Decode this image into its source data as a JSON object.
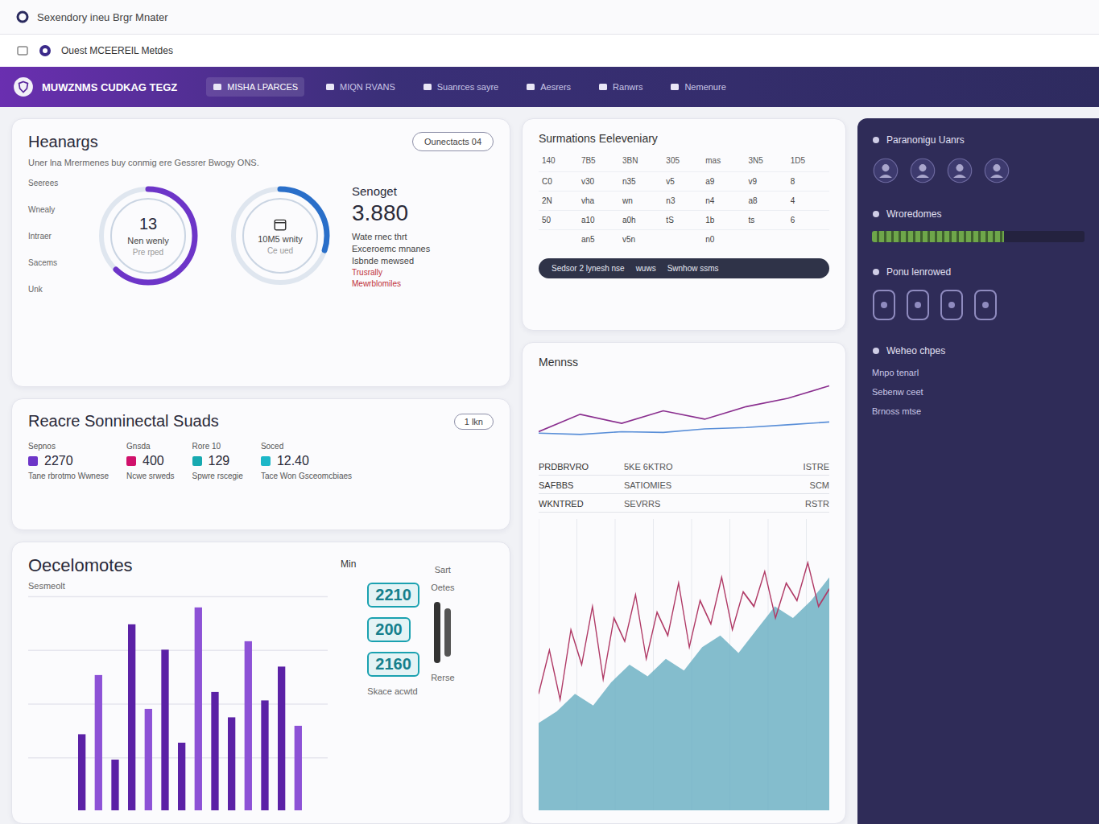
{
  "window": {
    "title": "Sexendory ineu Brgr Mnater",
    "subtitle": "Ouest MCEEREIL Metdes"
  },
  "nav": {
    "brand": "MUWZNMS CUDKAG TEGZ",
    "items": [
      {
        "label": "MISHA LPARCES",
        "selected": true
      },
      {
        "label": "MIQN RVANS",
        "selected": false
      },
      {
        "label": "Suanrces sayre",
        "selected": false
      },
      {
        "label": "Aesrers",
        "selected": false
      },
      {
        "label": "Ranwrs",
        "selected": false
      },
      {
        "label": "Nemenure",
        "selected": false
      }
    ]
  },
  "overview": {
    "title": "Heanargs",
    "subtitle": "Uner lna Mrermenes buy conmig ere Gessrer Bwogy ONS.",
    "button": "Ounectacts  04",
    "rows": [
      "Seerees",
      "Wnealy",
      "Intraer",
      "Sacems",
      "Unk"
    ],
    "rings": [
      {
        "value": "13",
        "label": "Nen wenly",
        "sub": "Pre rped",
        "level": 0.62
      },
      {
        "value": "",
        "label": "10M5 wnity",
        "sub": "Ce ued",
        "level": 0.3
      }
    ],
    "stat": {
      "title": "Senoget",
      "value": "3.880",
      "lines": [
        "Wate rnec thrt",
        "Exceroemc mnanes",
        "Isbnde mewsed"
      ],
      "alerts": [
        "Trusrally",
        "Mewrblomiles"
      ]
    }
  },
  "legend": {
    "title": "Reacre Sonninectal Suads",
    "button": "1 lkn",
    "items": [
      {
        "label": "Sepnos",
        "value": "2270",
        "note": "Tane rbrotmo Wwnese",
        "color": "#6d35c8"
      },
      {
        "label": "Gnsda",
        "value": "400",
        "note": "Ncwe srweds",
        "color": "#d0116b"
      },
      {
        "label": "Rore 10",
        "value": "129",
        "note": "Spwre rscegie",
        "color": "#17a9b0"
      },
      {
        "label": "Soced",
        "value": "12.40",
        "note": "Tace Won Gsceomcbiaes",
        "color": "#1cb7c8"
      }
    ]
  },
  "bars": {
    "title": "Oecelomotes",
    "axis": "Sesmeolt",
    "head": "Min",
    "values": [
      45,
      80,
      30,
      110,
      60,
      95,
      40,
      120,
      70,
      55,
      100,
      65,
      85,
      50
    ],
    "badges": [
      "2210",
      "200",
      "2160"
    ],
    "side": [
      "Sart",
      "Oetes"
    ],
    "foot": "Rerse",
    "note": "Skace acwtd"
  },
  "table": {
    "title": "Surmations Eeleveniary",
    "columns": [
      "140",
      "7B5",
      "3BN",
      "305",
      "mas",
      "3N5",
      "1D5"
    ],
    "rows": [
      [
        "C0",
        "v30",
        "n35",
        "v5",
        "a9",
        "v9",
        "8"
      ],
      [
        "2N",
        "vha",
        "wn",
        "n3",
        "n4",
        "a8",
        "4"
      ],
      [
        "50",
        "a10",
        "a0h",
        "tS",
        "1b",
        "ts",
        "6"
      ],
      [
        "",
        "an5",
        "v5n",
        "",
        "n0",
        "",
        ""
      ]
    ],
    "pill": [
      "Sedsor 2 lynesh nse",
      "wuws",
      "Swnhow ssms"
    ]
  },
  "trend": {
    "title": "Mennss",
    "series": [
      {
        "name": "purple",
        "color": "#8a2f8f",
        "values": [
          30,
          55,
          42,
          60,
          48,
          66,
          78,
          96
        ]
      },
      {
        "name": "blue",
        "color": "#5a8fd8",
        "values": [
          28,
          26,
          30,
          29,
          34,
          36,
          40,
          44
        ]
      }
    ],
    "rows": [
      {
        "label": "PRDBRVRO",
        "value": "5KE 6KTRO",
        "extra": "ISTRE"
      },
      {
        "label": "SAFBBS",
        "value": "SATIOMIES",
        "extra": "SCM"
      },
      {
        "label": "WKNTRED",
        "value": "SEVRRS",
        "extra": "RSTR"
      }
    ],
    "spark": [
      40,
      55,
      38,
      62,
      50,
      70,
      45,
      66,
      58,
      74,
      52,
      68,
      60,
      78,
      56,
      72,
      64,
      80,
      62,
      75,
      70,
      82,
      66,
      78,
      72,
      85,
      70,
      76
    ],
    "area": [
      30,
      34,
      40,
      36,
      44,
      50,
      46,
      52,
      48,
      56,
      60,
      54,
      62,
      70,
      66,
      72,
      80
    ]
  },
  "sidebar": {
    "sections": [
      {
        "title": "Paranonigu Uanrs",
        "kind": "icons"
      },
      {
        "title": "Wroredomes",
        "kind": "meter",
        "level": 0.62
      },
      {
        "title": "Ponu lenrowed",
        "kind": "tiles"
      },
      {
        "title": "Weheo chpes",
        "kind": "list",
        "lines": [
          "Mnpo tenarl",
          "Sebenw ceet",
          "Brnoss mtse"
        ]
      }
    ]
  }
}
